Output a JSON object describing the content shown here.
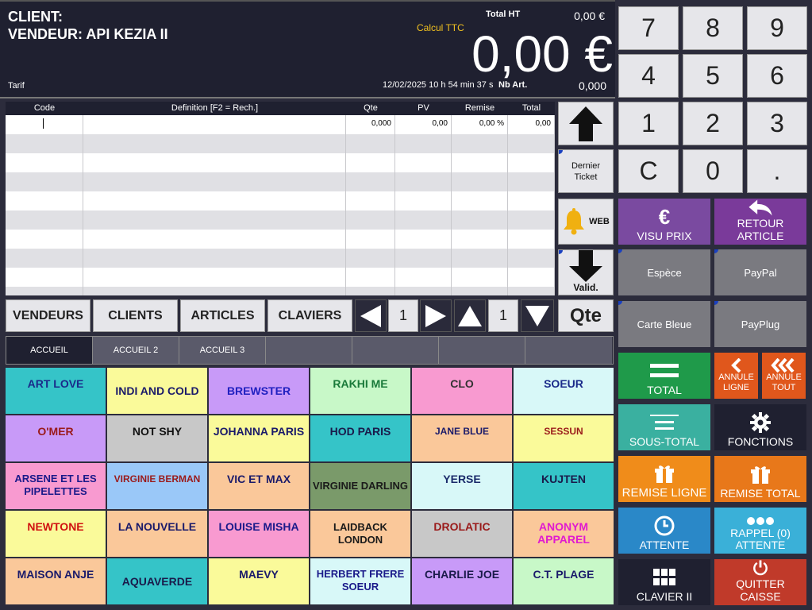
{
  "header": {
    "client_label": "CLIENT:",
    "vendeur_label": "VENDEUR: API KEZIA II",
    "tarif_label": "Tarif",
    "calcul_ttc": "Calcul TTC",
    "total_ht_label": "Total HT",
    "total_ht_value": "0,00 €",
    "total_ttc_value": "0,00 €",
    "datetime": "12/02/2025  10 h 54 min 37 s",
    "nb_art_label": "Nb Art.",
    "nb_art_value": "0,000"
  },
  "table": {
    "columns": [
      "Code",
      "Definition [F2 = Rech.]",
      "Qte",
      "PV",
      "Remise",
      "Total"
    ],
    "first_row": {
      "qte": "0,000",
      "pv": "0,00",
      "remise": "0,00 %",
      "total": "0,00"
    }
  },
  "side": {
    "dernier_ticket": "Dernier Ticket",
    "web": "WEB",
    "valid": "Valid."
  },
  "nav": {
    "vendeurs": "VENDEURS",
    "clients": "CLIENTS",
    "articles": "ARTICLES",
    "claviers": "CLAVIERS",
    "page_h": "1",
    "page_v": "1",
    "qte": "Qte"
  },
  "tabs": [
    "ACCUEIL",
    "ACCUEIL 2",
    "ACCUEIL 3",
    "",
    "",
    "",
    ""
  ],
  "articles": [
    {
      "label": "ART LOVE",
      "bg": "#35c4c8",
      "fg": "#1a2a8a",
      "valign": "top"
    },
    {
      "label": "INDI AND COLD",
      "bg": "#fafa9a",
      "fg": "#1a1a6a",
      "valign": "center"
    },
    {
      "label": "BREWSTER",
      "bg": "#c89af8",
      "fg": "#2020c0",
      "valign": "center"
    },
    {
      "label": "RAKHI ME",
      "bg": "#c8f8c8",
      "fg": "#1a7a3a",
      "valign": "top"
    },
    {
      "label": "CLO",
      "bg": "#f89ad0",
      "fg": "#333333",
      "valign": "top"
    },
    {
      "label": "SOEUR",
      "bg": "#d8f8f8",
      "fg": "#1a2a8a",
      "valign": "top"
    },
    {
      "label": "O'MER",
      "bg": "#c89af8",
      "fg": "#9a1a1a",
      "valign": "top"
    },
    {
      "label": "NOT SHY",
      "bg": "#c8c8c8",
      "fg": "#111111",
      "valign": "top"
    },
    {
      "label": "JOHANNA PARIS",
      "bg": "#fafa9a",
      "fg": "#1a1a6a",
      "valign": "top"
    },
    {
      "label": "HOD PARIS",
      "bg": "#35c4c8",
      "fg": "#1a1a4a",
      "valign": "top"
    },
    {
      "label": "JANE BLUE",
      "bg": "#fac89a",
      "fg": "#1a1a6a",
      "valign": "top"
    },
    {
      "label": "SESSUN",
      "bg": "#fafa9a",
      "fg": "#9a1a1a",
      "valign": "top"
    },
    {
      "label": "ARSENE ET LES PIPELETTES",
      "bg": "#f89ad0",
      "fg": "#1a1a8a",
      "valign": "top"
    },
    {
      "label": "VIRGINIE BERMAN",
      "bg": "#9ac8f8",
      "fg": "#9a1a1a",
      "valign": "top"
    },
    {
      "label": "VIC ET MAX",
      "bg": "#fac89a",
      "fg": "#1a1a6a",
      "valign": "top"
    },
    {
      "label": "VIRGINIE DARLING",
      "bg": "#7a9a6a",
      "fg": "#1a1a1a",
      "valign": "center"
    },
    {
      "label": "YERSE",
      "bg": "#d8f8f8",
      "fg": "#1a2a6a",
      "valign": "top"
    },
    {
      "label": "KUJTEN",
      "bg": "#35c4c8",
      "fg": "#1a1a4a",
      "valign": "top"
    },
    {
      "label": "NEWTONE",
      "bg": "#fafa9a",
      "fg": "#d01010",
      "valign": "top"
    },
    {
      "label": "LA NOUVELLE",
      "bg": "#fac89a",
      "fg": "#1a1a6a",
      "valign": "top"
    },
    {
      "label": "LOUISE MISHA",
      "bg": "#f89ad0",
      "fg": "#1a1a8a",
      "valign": "top"
    },
    {
      "label": "LAIDBACK LONDON",
      "bg": "#fac89a",
      "fg": "#1a1a1a",
      "valign": "center"
    },
    {
      "label": "DROLATIC",
      "bg": "#c8c8c8",
      "fg": "#9a1a1a",
      "valign": "top"
    },
    {
      "label": "ANONYM APPAREL",
      "bg": "#fac89a",
      "fg": "#e01ad0",
      "valign": "top"
    },
    {
      "label": "MAISON ANJE",
      "bg": "#fac89a",
      "fg": "#1a1a6a",
      "valign": "top"
    },
    {
      "label": "AQUAVERDE",
      "bg": "#35c4c8",
      "fg": "#1a1a4a",
      "valign": "center"
    },
    {
      "label": "MAEVY",
      "bg": "#fafa9a",
      "fg": "#1a1a6a",
      "valign": "top"
    },
    {
      "label": "HERBERT FRERE SOEUR",
      "bg": "#d8f8f8",
      "fg": "#1a1a8a",
      "valign": "top"
    },
    {
      "label": "CHARLIE JOE",
      "bg": "#c89af8",
      "fg": "#1a1a4a",
      "valign": "top"
    },
    {
      "label": "C.T. PLAGE",
      "bg": "#c8f8c8",
      "fg": "#1a1a6a",
      "valign": "top"
    }
  ],
  "numpad": [
    "7",
    "8",
    "9",
    "4",
    "5",
    "6",
    "1",
    "2",
    "3",
    "C",
    "0",
    "."
  ],
  "actions": {
    "visu_prix": "VISU PRIX",
    "retour_article": "RETOUR ARTICLE",
    "espece": "Espèce",
    "paypal": "PayPal",
    "carte_bleue": "Carte Bleue",
    "payplug": "PayPlug",
    "total": "TOTAL",
    "annule_ligne": "ANNULE LIGNE",
    "annule_tout": "ANNULE TOUT",
    "sous_total": "SOUS-TOTAL",
    "fonctions": "FONCTIONS",
    "remise_ligne": "REMISE LIGNE",
    "remise_total": "REMISE TOTAL",
    "attente": "ATTENTE",
    "rappel_attente": "RAPPEL (0) ATTENTE",
    "clavier_ii": "CLAVIER II",
    "quitter_caisse": "QUITTER CAISSE",
    "euro_symbol": "€"
  },
  "colors": {
    "purple": "#7a3a9a",
    "green": "#1f9a4a",
    "teal": "#3ab0a0",
    "dark": "#1f2030",
    "orange": "#f08020",
    "blue": "#2a88c8",
    "lightblue": "#3ab0d8",
    "red": "#c03a2a",
    "gray": "#7a7a80"
  }
}
